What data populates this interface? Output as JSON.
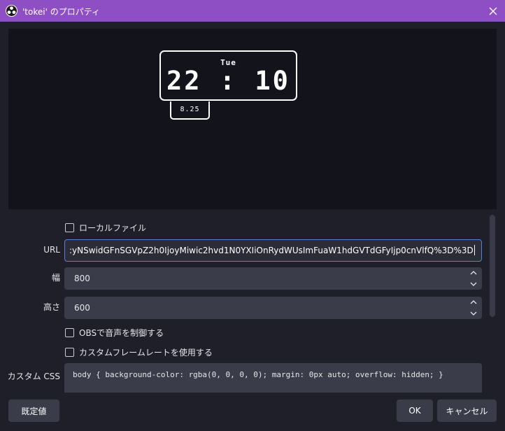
{
  "window": {
    "title": "'tokei' のプロパティ",
    "app_icon": "obs-icon",
    "close_icon": "close-icon"
  },
  "preview": {
    "day": "Tue",
    "time": "22 : 10",
    "date": "8.25"
  },
  "form": {
    "local_file_label": "ローカルファイル",
    "url_label": "URL",
    "url_value": ":yNSwidGFnSGVpZ2h0IjoyMiwic2hvd1N0YXIiOnRydWUsImFuaW1hdGVTdGFyIjp0cnVlfQ%3D%3D",
    "width_label": "幅",
    "width_value": "800",
    "height_label": "高さ",
    "height_value": "600",
    "obs_audio_label": "OBSで音声を制御する",
    "custom_fps_label": "カスタムフレームレートを使用する",
    "css_label": "カスタム CSS",
    "css_value": "body { background-color: rgba(0, 0, 0, 0); margin: 0px auto; overflow: hidden; }"
  },
  "buttons": {
    "defaults": "既定値",
    "ok": "OK",
    "cancel": "キャンセル"
  },
  "colors": {
    "titlebar": "#8f4fc4",
    "background": "#1e1f29",
    "preview_bg": "#12131b",
    "field_bg": "#3a3c4a",
    "focus_border": "#5a7fd3"
  }
}
